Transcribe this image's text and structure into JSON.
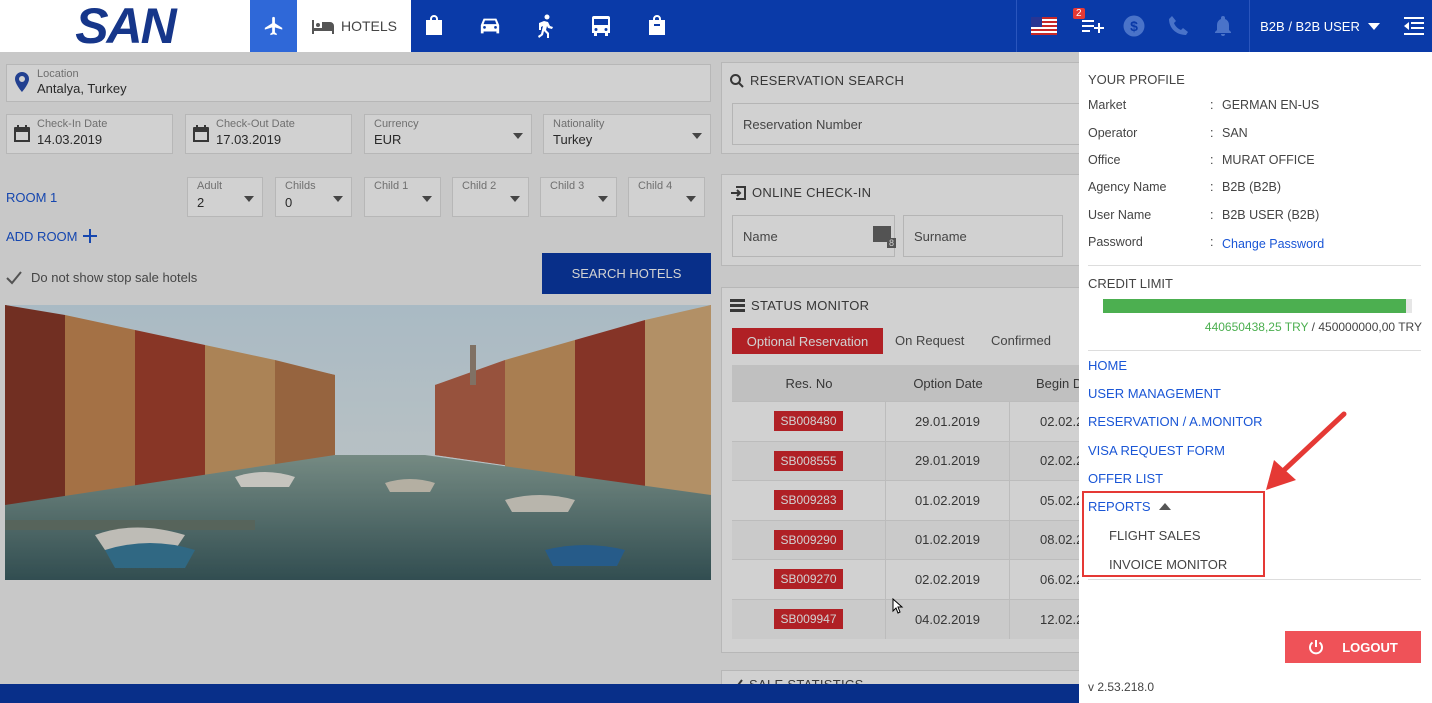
{
  "logo": "SAN",
  "nav": {
    "hotels_label": "HOTELS"
  },
  "top": {
    "notification_count": "2",
    "user_label": "B2B / B2B USER"
  },
  "search": {
    "location_label": "Location",
    "location_value": "Antalya, Turkey",
    "checkin_label": "Check-In Date",
    "checkin_value": "14.03.2019",
    "checkout_label": "Check-Out Date",
    "checkout_value": "17.03.2019",
    "currency_label": "Currency",
    "currency_value": "EUR",
    "nationality_label": "Nationality",
    "nationality_value": "Turkey",
    "room_label": "ROOM 1",
    "adult_label": "Adult",
    "adult_value": "2",
    "childs_label": "Childs",
    "childs_value": "0",
    "child1_label": "Child 1",
    "child2_label": "Child 2",
    "child3_label": "Child 3",
    "child4_label": "Child 4",
    "add_room_label": "ADD ROOM",
    "stop_sale_label": "Do not show stop sale hotels",
    "search_button": "SEARCH HOTELS"
  },
  "reservation_search": {
    "title": "RESERVATION SEARCH",
    "placeholder": "Reservation Number"
  },
  "checkin_panel": {
    "title": "ONLINE CHECK-IN",
    "name_placeholder": "Name",
    "surname_placeholder": "Surname",
    "icon_count": "8"
  },
  "status_monitor": {
    "title": "STATUS MONITOR",
    "tabs": [
      "Optional Reservation",
      "On Request",
      "Confirmed"
    ],
    "columns": [
      "Res. No",
      "Option Date",
      "Begin D"
    ],
    "rows": [
      {
        "res_no": "SB008480",
        "option_date": "29.01.2019",
        "begin": "02.02.2"
      },
      {
        "res_no": "SB008555",
        "option_date": "29.01.2019",
        "begin": "02.02.2"
      },
      {
        "res_no": "SB009283",
        "option_date": "01.02.2019",
        "begin": "05.02.2"
      },
      {
        "res_no": "SB009290",
        "option_date": "01.02.2019",
        "begin": "08.02.2"
      },
      {
        "res_no": "SB009270",
        "option_date": "02.02.2019",
        "begin": "06.02.2"
      },
      {
        "res_no": "SB009947",
        "option_date": "04.02.2019",
        "begin": "12.02.2"
      }
    ]
  },
  "sale_statistics": {
    "title": "SALE STATISTICS"
  },
  "profile": {
    "title": "YOUR PROFILE",
    "market_key": "Market",
    "market_val": "GERMAN EN-US",
    "operator_key": "Operator",
    "operator_val": "SAN",
    "office_key": "Office",
    "office_val": "MURAT OFFICE",
    "agency_key": "Agency Name",
    "agency_val": "B2B (B2B)",
    "user_key": "User Name",
    "user_val": "B2B USER (B2B)",
    "password_key": "Password",
    "password_link": "Change Password",
    "colon": ":"
  },
  "credit": {
    "title": "CREDIT LIMIT",
    "used": "440650438,25 TRY",
    "separator": " / ",
    "total": "450000000,00 TRY",
    "fill_fraction": 0.979
  },
  "menu": {
    "home": "HOME",
    "user_management": "USER MANAGEMENT",
    "reservation_monitor": "RESERVATION / A.MONITOR",
    "visa_request": "VISA REQUEST FORM",
    "offer_list": "OFFER LIST",
    "reports": "REPORTS",
    "flight_sales": "FLIGHT SALES",
    "invoice_monitor": "INVOICE MONITOR"
  },
  "logout_label": "LOGOUT",
  "version": "v 2.53.218.0",
  "colors": {
    "brand_blue": "#0a3aa8",
    "accent_red": "#d7282e",
    "credit_green": "#4caf50",
    "link_blue": "#1a56d6"
  }
}
